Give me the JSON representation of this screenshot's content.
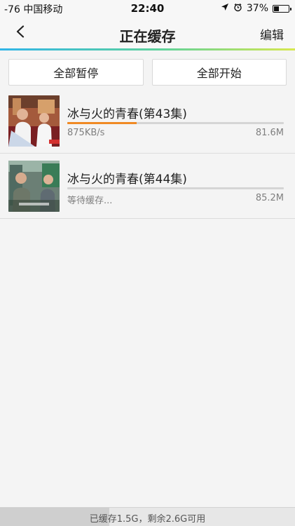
{
  "status_bar": {
    "carrier": "-76 中国移动",
    "time": "22:40",
    "battery": "37%",
    "battery_level": 0.37
  },
  "nav": {
    "title": "正在缓存",
    "edit_label": "编辑"
  },
  "actions": {
    "pause_all": "全部暂停",
    "start_all": "全部开始"
  },
  "downloads": [
    {
      "title": "冰与火的青春(第43集)",
      "status": "875KB/s",
      "size": "81.6M",
      "progress": 0.32
    },
    {
      "title": "冰与火的青春(第44集)",
      "status": "等待缓存...",
      "size": "85.2M",
      "progress": 0
    }
  ],
  "storage": {
    "text": "已缓存1.5G，剩余2.6G可用",
    "used_fraction": 0.37
  },
  "icons": {
    "back": "chevron-left-icon",
    "location": "location-arrow-icon",
    "alarm": "alarm-icon",
    "battery": "battery-icon"
  },
  "colors": {
    "progress": "#f08a24",
    "accent_start": "#31b5e8",
    "accent_end": "#d8e84f"
  }
}
